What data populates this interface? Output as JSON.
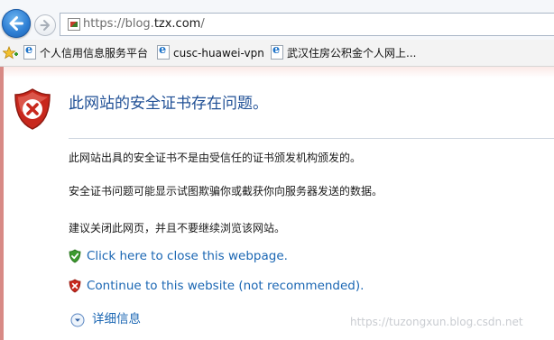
{
  "address_bar": {
    "url_prefix": "https://blog.",
    "url_domain": "tzx.com",
    "url_suffix": "/"
  },
  "favorites": {
    "items": [
      {
        "label": "个人信用信息服务平台"
      },
      {
        "label": "cusc-huawei-vpn"
      },
      {
        "label": "武汉住房公积金个人网上..."
      }
    ]
  },
  "error_page": {
    "title": "此网站的安全证书存在问题。",
    "paragraphs": [
      "此网站出具的安全证书不是由受信任的证书颁发机构颁发的。",
      "安全证书问题可能显示试图欺骗你或截获你向服务器发送的数据。",
      "建议关闭此网页，并且不要继续浏览该网站。"
    ],
    "close_link": "Click here to close this webpage.",
    "continue_link": "Continue to this website (not recommended).",
    "more_info": "详细信息"
  },
  "watermark": "https://tuzongxun.blog.csdn.net",
  "colors": {
    "title": "#1f4f95",
    "link": "#1a66b3",
    "shield_red": "#c8281d",
    "shield_green": "#3c9a2f"
  }
}
